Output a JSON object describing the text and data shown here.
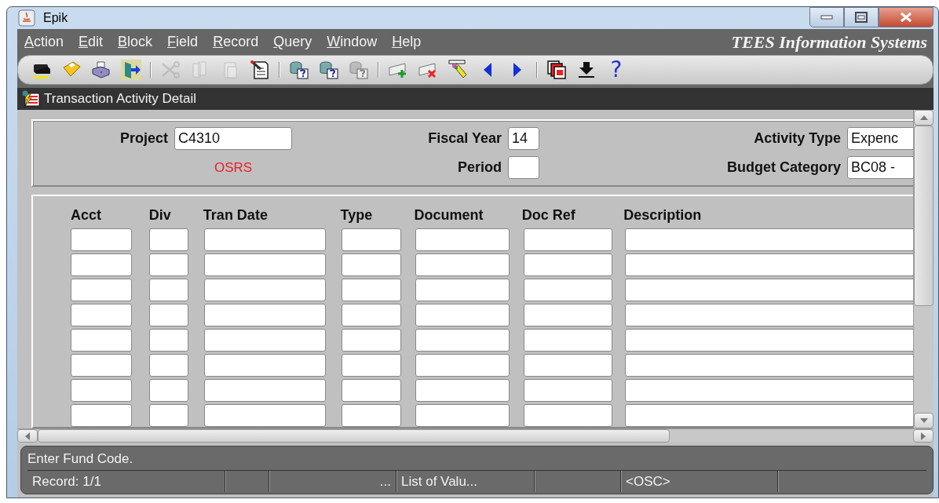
{
  "window": {
    "title": "Epik"
  },
  "menu": {
    "items": [
      "Action",
      "Edit",
      "Block",
      "Field",
      "Record",
      "Query",
      "Window",
      "Help"
    ],
    "brand": "TEES Information Systems"
  },
  "toolbar": [
    {
      "kind": "clear",
      "disabled": false
    },
    {
      "kind": "save",
      "disabled": false
    },
    {
      "kind": "print",
      "disabled": false
    },
    {
      "kind": "exit",
      "disabled": false
    },
    {
      "kind": "separator"
    },
    {
      "kind": "cut",
      "disabled": true
    },
    {
      "kind": "copy",
      "disabled": true
    },
    {
      "kind": "paste",
      "disabled": true
    },
    {
      "kind": "edit",
      "disabled": false
    },
    {
      "kind": "separator"
    },
    {
      "kind": "query",
      "disabled": false
    },
    {
      "kind": "query",
      "disabled": false
    },
    {
      "kind": "query",
      "disabled": true
    },
    {
      "kind": "separator"
    },
    {
      "kind": "insert",
      "disabled": false
    },
    {
      "kind": "delete",
      "disabled": false
    },
    {
      "kind": "highlight",
      "disabled": false
    },
    {
      "kind": "previous",
      "disabled": false
    },
    {
      "kind": "next",
      "disabled": false
    },
    {
      "kind": "separator"
    },
    {
      "kind": "stack",
      "disabled": false
    },
    {
      "kind": "download",
      "disabled": false
    },
    {
      "kind": "help",
      "label": "?",
      "disabled": false
    }
  ],
  "form": {
    "title": "Transaction Activity Detail",
    "header": {
      "project": {
        "label": "Project",
        "value": "C4310"
      },
      "project_name": "OSRS",
      "fiscal_year": {
        "label": "Fiscal Year",
        "value": "14"
      },
      "period": {
        "label": "Period"
      },
      "activity_type": {
        "label": "Activity Type",
        "value": "Expenc"
      },
      "budget_category": {
        "label": "Budget Category",
        "value": "BC08 -"
      }
    },
    "table": {
      "columns": [
        "Acct",
        "Div",
        "Tran Date",
        "Type",
        "Document",
        "Doc Ref",
        "Description"
      ]
    }
  },
  "message": "Enter Fund Code.",
  "status_bar": {
    "record": "Record: 1/1",
    "ellipsis": "...",
    "list_of_values": "List of Valu...",
    "mode": "<OSC>"
  }
}
